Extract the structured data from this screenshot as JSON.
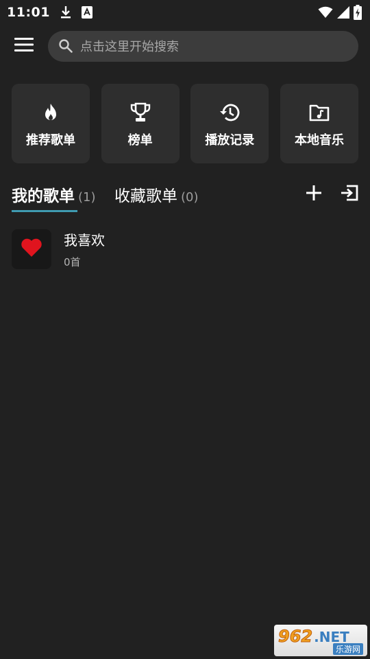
{
  "status_bar": {
    "time": "11:01",
    "left_icons": [
      "download-icon",
      "a-keyboard-icon"
    ],
    "right_icons": [
      "wifi-icon",
      "signal-icon",
      "battery-charging-icon"
    ]
  },
  "search": {
    "placeholder": "点击这里开始搜索"
  },
  "quick_actions": [
    {
      "label": "推荐歌单",
      "icon": "fire-icon"
    },
    {
      "label": "榜单",
      "icon": "trophy-icon"
    },
    {
      "label": "播放记录",
      "icon": "history-icon"
    },
    {
      "label": "本地音乐",
      "icon": "music-folder-icon"
    }
  ],
  "tabs": [
    {
      "label": "我的歌单",
      "count": "(1)",
      "active": true
    },
    {
      "label": "收藏歌单",
      "count": "(0)",
      "active": false
    }
  ],
  "tab_actions": [
    "add-icon",
    "import-icon"
  ],
  "playlists": [
    {
      "title": "我喜欢",
      "count": "0首",
      "icon": "heart-icon"
    }
  ],
  "watermark": {
    "number": "962",
    "net": ".NET",
    "sub": "乐游网"
  },
  "colors": {
    "background": "#212121",
    "card": "#2e2e2e",
    "search_bg": "#3c3c3c",
    "accent_underline": "#3f9bb1",
    "heart": "#e0141e"
  }
}
